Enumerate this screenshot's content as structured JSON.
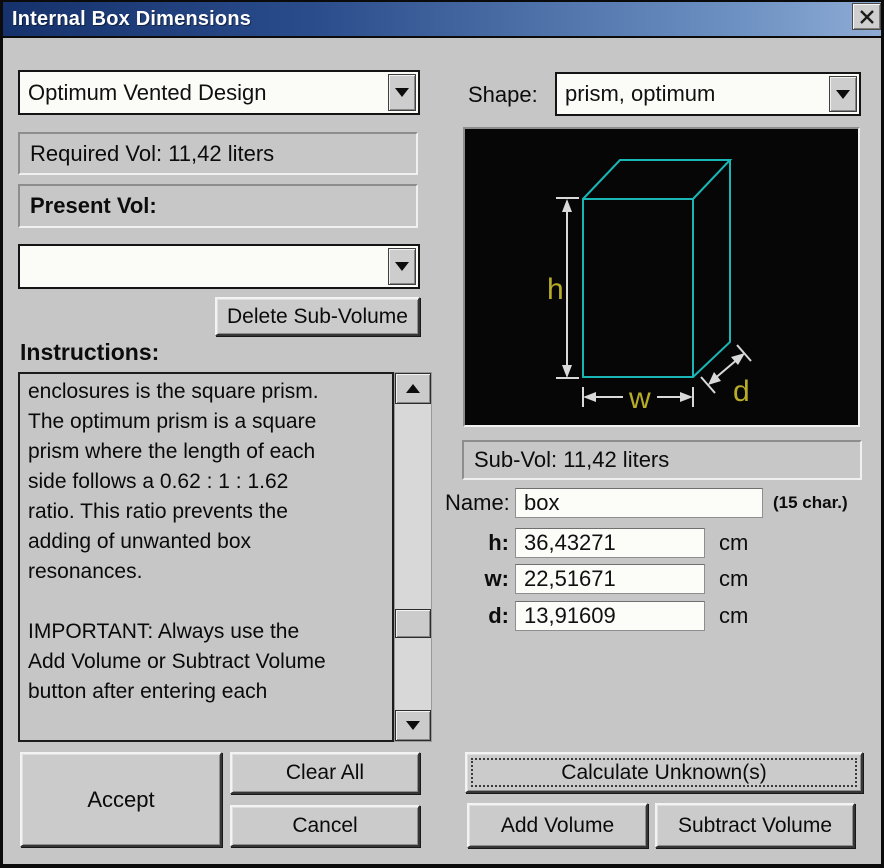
{
  "window": {
    "title": "Internal Box Dimensions"
  },
  "left": {
    "design_select": "Optimum Vented Design",
    "required_vol": "Required Vol: 11,42 liters",
    "present_vol": "Present Vol:",
    "subvolume_select": "",
    "delete_button": "Delete Sub-Volume",
    "instructions_label": "Instructions:",
    "instructions_text": "enclosures is the square prism.\nThe optimum prism is a square\nprism where the length of each\nside follows a 0.62 : 1 : 1.62\nratio. This ratio prevents the\nadding of unwanted box\nresonances.\n\nIMPORTANT: Always use the\nAdd Volume or Subtract Volume\nbutton after entering each"
  },
  "right": {
    "shape_label": "Shape:",
    "shape_select": "prism, optimum",
    "sub_vol": "Sub-Vol: 11,42 liters",
    "name_label": "Name:",
    "name_value": "box",
    "name_hint": "(15 char.)",
    "dims": [
      {
        "label": "h:",
        "value": "36,43271",
        "unit": "cm"
      },
      {
        "label": "w:",
        "value": "22,51671",
        "unit": "cm"
      },
      {
        "label": "d:",
        "value": "13,91609",
        "unit": "cm"
      }
    ],
    "diagram": {
      "h": "h",
      "w": "w",
      "d": "d",
      "wire_color": "#1ab6b6",
      "dim_color": "#d9d9d9",
      "label_color": "#b7ad28",
      "bg": "#060606"
    }
  },
  "actions": {
    "accept": "Accept",
    "clear_all": "Clear All",
    "cancel": "Cancel",
    "calculate": "Calculate Unknown(s)",
    "add_volume": "Add Volume",
    "subtract_volume": "Subtract Volume"
  }
}
